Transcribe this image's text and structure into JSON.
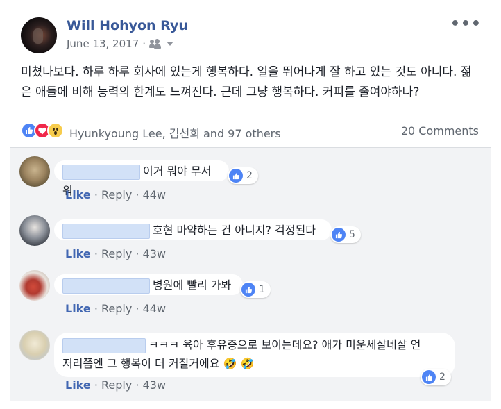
{
  "post": {
    "author": "Will Hohyon Ryu",
    "date": "June 13, 2017",
    "date_sep": "·",
    "audience_icon": "friends-icon",
    "more_icon": "ellipsis",
    "more_glyph": "•••",
    "text": "미쳤나보다. 하루 하루 회사에 있는게 행복하다. 일을 뛰어나게 잘 하고 있는 것도 아니다. 젊은 애들에 비해 능력의 한계도 느껴진다. 근데 그냥 행복하다. 커피를 줄여야하나?"
  },
  "reactions": {
    "types": [
      "like",
      "love",
      "wow"
    ],
    "reactors": "Hyunkyoung Lee, 김선희 and 97 others",
    "comments_count": "20 Comments"
  },
  "comments": [
    {
      "text": "이거 뭐야 무서워",
      "likes": "2",
      "like_label": "Like",
      "reply_label": "Reply",
      "time": "44w"
    },
    {
      "text": "호현 마약하는 건 아니지? 걱정된다",
      "likes": "5",
      "like_label": "Like",
      "reply_label": "Reply",
      "time": "43w"
    },
    {
      "text": "병원에 빨리 가봐",
      "likes": "1",
      "like_label": "Like",
      "reply_label": "Reply",
      "time": "44w"
    },
    {
      "text_line1": "ㅋㅋㅋ 육아 후유증으로 보이는데요? 애가 미운세살네살 언",
      "text_line2": "저리쯤엔 그 행복이 더 커질거에요",
      "emoji": "🤣 🤣",
      "likes": "2",
      "like_label": "Like",
      "reply_label": "Reply",
      "time": "43w"
    }
  ],
  "colors": {
    "link": "#385898",
    "like_blue": "#4267b2",
    "reaction_like": "#4e84f5",
    "reaction_love": "#f0284a",
    "reaction_wow": "#f7cc4c"
  }
}
